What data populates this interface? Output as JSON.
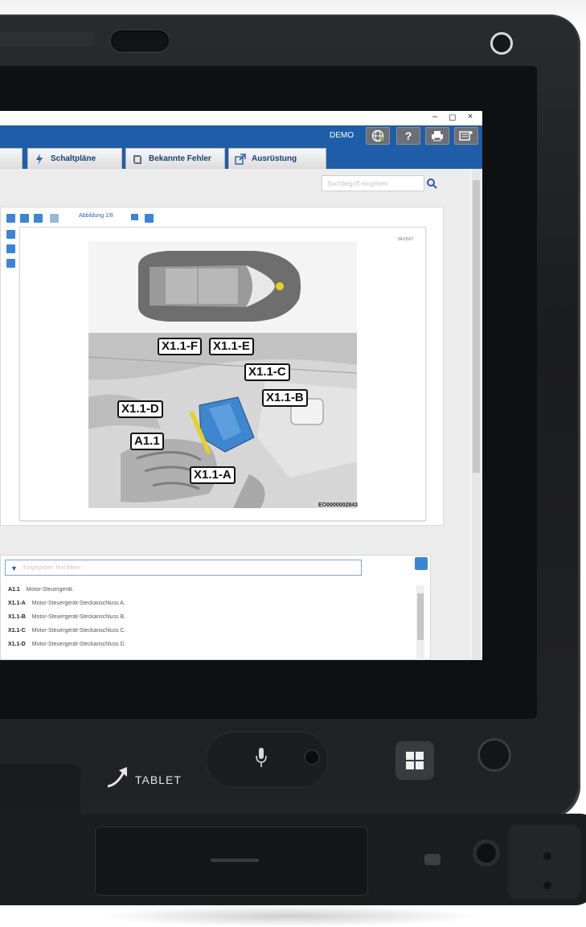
{
  "window": {
    "minimize": "–",
    "maximize": "◻",
    "close": "×"
  },
  "header": {
    "demo_label": "DEMO",
    "buttons": [
      "globe-icon",
      "help-icon",
      "print-icon",
      "menu-icon"
    ],
    "help_label": "?"
  },
  "tabs": [
    {
      "label": "Schaltpläne",
      "icon": "bolt-icon"
    },
    {
      "label": "Bekannte Fehler",
      "icon": "book-icon"
    },
    {
      "label": "Ausrüstung",
      "icon": "external-link-icon"
    }
  ],
  "search": {
    "placeholder": "Suchbegriff eingeben"
  },
  "viewer": {
    "figure_label": "Abbildung 1/8",
    "figure_code": "8410507",
    "image_code": "EO0000002843",
    "callouts": [
      "X1.1-F",
      "X1.1-E",
      "X1.1-C",
      "X1.1-B",
      "X1.1-D",
      "A1.1",
      "X1.1-A"
    ]
  },
  "legend": {
    "filter_placeholder": "Eingegeben Text filtern",
    "rows": [
      {
        "code": "A1.1",
        "desc": "Motor-Steuergerät."
      },
      {
        "code": "X1.1-A",
        "desc": "Motor-Steuergerät-Steckanschluss A."
      },
      {
        "code": "X1.1-B",
        "desc": "Motor-Steuergerät-Steckanschluss B."
      },
      {
        "code": "X1.1-C",
        "desc": "Motor-Steuergerät-Steckanschluss C."
      },
      {
        "code": "X1.1-D",
        "desc": "Motor-Steuergerät-Steckanschluss D."
      }
    ]
  },
  "device": {
    "tablet_label": "TABLET"
  },
  "colors": {
    "header_blue": "#1e5ea8",
    "tool_blue": "#3a86d6",
    "connector_blue": "#3f86d0",
    "wire_yellow": "#e8d21a"
  }
}
